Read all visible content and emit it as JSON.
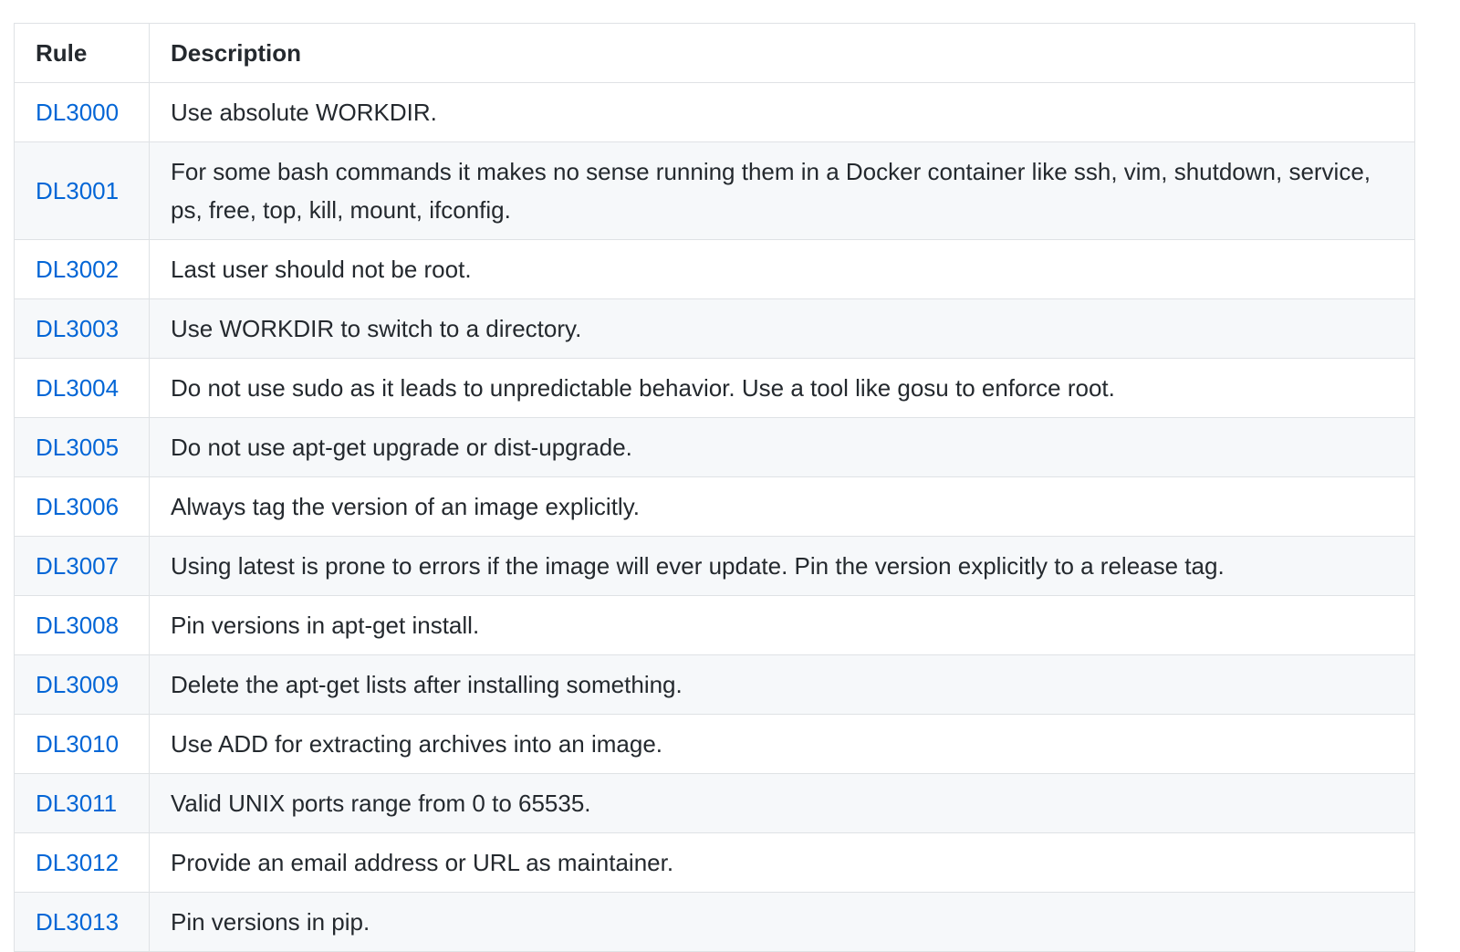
{
  "table": {
    "headers": {
      "rule": "Rule",
      "description": "Description"
    },
    "rows": [
      {
        "rule": "DL3000",
        "description": "Use absolute WORKDIR."
      },
      {
        "rule": "DL3001",
        "description": "For some bash commands it makes no sense running them in a Docker container like ssh, vim, shutdown, service, ps, free, top, kill, mount, ifconfig."
      },
      {
        "rule": "DL3002",
        "description": "Last user should not be root."
      },
      {
        "rule": "DL3003",
        "description": "Use WORKDIR to switch to a directory."
      },
      {
        "rule": "DL3004",
        "description": "Do not use sudo as it leads to unpredictable behavior. Use a tool like gosu to enforce root."
      },
      {
        "rule": "DL3005",
        "description": "Do not use apt-get upgrade or dist-upgrade."
      },
      {
        "rule": "DL3006",
        "description": "Always tag the version of an image explicitly."
      },
      {
        "rule": "DL3007",
        "description": "Using latest is prone to errors if the image will ever update. Pin the version explicitly to a release tag."
      },
      {
        "rule": "DL3008",
        "description": "Pin versions in apt-get install."
      },
      {
        "rule": "DL3009",
        "description": "Delete the apt-get lists after installing something."
      },
      {
        "rule": "DL3010",
        "description": "Use ADD for extracting archives into an image."
      },
      {
        "rule": "DL3011",
        "description": "Valid UNIX ports range from 0 to 65535."
      },
      {
        "rule": "DL3012",
        "description": "Provide an email address or URL as maintainer."
      },
      {
        "rule": "DL3013",
        "description": "Pin versions in pip."
      }
    ]
  },
  "colors": {
    "link": "#0366d6",
    "text": "#24292e",
    "border": "#dfe2e5",
    "stripe": "#f6f8fa"
  }
}
